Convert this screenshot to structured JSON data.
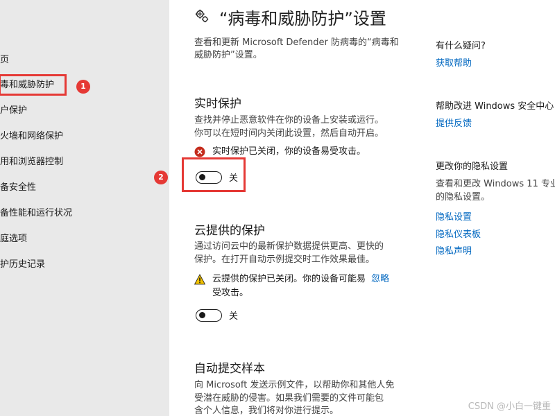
{
  "sidebar": {
    "items": [
      {
        "label": "页"
      },
      {
        "label": "毒和威胁防护"
      },
      {
        "label": "户保护"
      },
      {
        "label": "火墙和网络保护"
      },
      {
        "label": "用和浏览器控制"
      },
      {
        "label": "备安全性"
      },
      {
        "label": "备性能和运行状况"
      },
      {
        "label": "庭选项"
      },
      {
        "label": "护历史记录"
      }
    ]
  },
  "callouts": {
    "one": "1",
    "two": "2"
  },
  "page": {
    "title": "“病毒和威胁防护”设置",
    "description_line1": "查看和更新 Microsoft Defender 防病毒的“病毒和",
    "description_line2": "威胁防护”设置。"
  },
  "realtime": {
    "heading": "实时保护",
    "desc_line1": "查找并停止恶意软件在你的设备上安装或运行。",
    "desc_line2": "你可以在短时间内关闭此设置，然后自动开启。",
    "status": "实时保护已关闭，你的设备易受攻击。",
    "toggle_label": "关"
  },
  "cloud": {
    "heading": "云提供的保护",
    "desc_line1": "通过访问云中的最新保护数据提供更高、更快的",
    "desc_line2": "保护。在打开自动示例提交时工作效果最佳。",
    "status_line1": "云提供的保护已关闭。你的设备可能易",
    "status_line2": "受攻击。",
    "dismiss": "忽略",
    "toggle_label": "关"
  },
  "sample": {
    "heading": "自动提交样本",
    "desc_line1": "向 Microsoft 发送示例文件，以帮助你和其他人免",
    "desc_line2": "受潜在威胁的侵害。如果我们需要的文件可能包",
    "desc_line3": "含个人信息，我们将对你进行提示。"
  },
  "right": {
    "questions_heading": "有什么疑问?",
    "get_help": "获取帮助",
    "improve_heading": "帮助改进 Windows 安全中心",
    "feedback": "提供反馈",
    "privacy_heading": "更改你的隐私设置",
    "privacy_text_line1": "查看和更改 Windows 11 专业",
    "privacy_text_line2": "的隐私设置。",
    "privacy_settings": "隐私设置",
    "privacy_dashboard": "隐私仪表板",
    "privacy_statement": "隐私声明"
  },
  "watermark": "CSDN @小白一键重",
  "colors": {
    "accent": "#0067c0",
    "highlight": "#e53935",
    "sidebar_bg": "#e9e9e9",
    "warning": "#f2c200",
    "error": "#c42b1c"
  }
}
